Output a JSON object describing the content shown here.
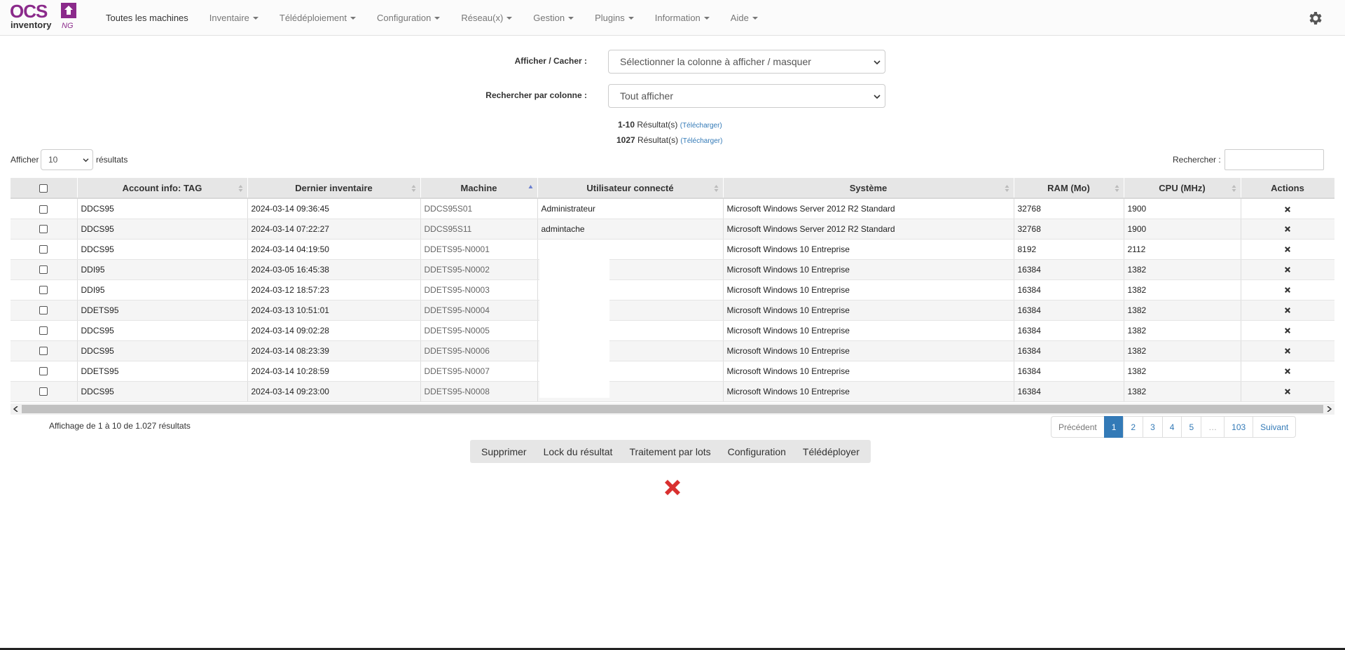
{
  "navbar": {
    "logo_text": "OCS inventory NG",
    "items": [
      {
        "label": "Toutes les machines"
      },
      {
        "label": "Inventaire"
      },
      {
        "label": "Télédéploiement"
      },
      {
        "label": "Configuration"
      },
      {
        "label": "Réseau(x)"
      },
      {
        "label": "Gestion"
      },
      {
        "label": "Plugins"
      },
      {
        "label": "Information"
      },
      {
        "label": "Aide"
      }
    ],
    "settings_icon": "gear-icon"
  },
  "filters": {
    "show_hide_label": "Afficher / Cacher :",
    "show_hide_value": "Sélectionner la colonne à afficher / masquer",
    "search_col_label": "Rechercher par colonne :",
    "search_col_value": "Tout afficher"
  },
  "results": {
    "range": "1-10",
    "range_suffix": "Résultat(s)",
    "range_link": "(Télécharger)",
    "total": "1027",
    "total_suffix": "Résultat(s)",
    "total_link": "(Télécharger)"
  },
  "length": {
    "prefix": "Afficher",
    "value": "10",
    "suffix": "résultats"
  },
  "search": {
    "label": "Rechercher :",
    "value": ""
  },
  "table": {
    "columns": [
      "Account info: TAG",
      "Dernier inventaire",
      "Machine",
      "Utilisateur connecté",
      "Système",
      "RAM (Mo)",
      "CPU (MHz)",
      "Actions"
    ],
    "rows": [
      {
        "tag": "DDCS95",
        "date": "2024-03-14 09:36:45",
        "machine": "DDCS95S01",
        "user": "Administrateur",
        "os": "Microsoft Windows Server 2012 R2 Standard",
        "ram": "32768",
        "cpu": "1900"
      },
      {
        "tag": "DDCS95",
        "date": "2024-03-14 07:22:27",
        "machine": "DDCS95S11",
        "user": "admintache",
        "os": "Microsoft Windows Server 2012 R2 Standard",
        "ram": "32768",
        "cpu": "1900"
      },
      {
        "tag": "DDCS95",
        "date": "2024-03-14 04:19:50",
        "machine": "DDETS95-N0001",
        "user": "",
        "os": "Microsoft Windows 10 Entreprise",
        "ram": "8192",
        "cpu": "2112"
      },
      {
        "tag": "DDI95",
        "date": "2024-03-05 16:45:38",
        "machine": "DDETS95-N0002",
        "user": "",
        "os": "Microsoft Windows 10 Entreprise",
        "ram": "16384",
        "cpu": "1382"
      },
      {
        "tag": "DDI95",
        "date": "2024-03-12 18:57:23",
        "machine": "DDETS95-N0003",
        "user": "",
        "os": "Microsoft Windows 10 Entreprise",
        "ram": "16384",
        "cpu": "1382"
      },
      {
        "tag": "DDETS95",
        "date": "2024-03-13 10:51:01",
        "machine": "DDETS95-N0004",
        "user": "",
        "os": "Microsoft Windows 10 Entreprise",
        "ram": "16384",
        "cpu": "1382"
      },
      {
        "tag": "DDCS95",
        "date": "2024-03-14 09:02:28",
        "machine": "DDETS95-N0005",
        "user": "",
        "os": "Microsoft Windows 10 Entreprise",
        "ram": "16384",
        "cpu": "1382"
      },
      {
        "tag": "DDCS95",
        "date": "2024-03-14 08:23:39",
        "machine": "DDETS95-N0006",
        "user": "",
        "os": "Microsoft Windows 10 Entreprise",
        "ram": "16384",
        "cpu": "1382"
      },
      {
        "tag": "DDETS95",
        "date": "2024-03-14 10:28:59",
        "machine": "DDETS95-N0007",
        "user": "",
        "os": "Microsoft Windows 10 Entreprise",
        "ram": "16384",
        "cpu": "1382"
      },
      {
        "tag": "DDCS95",
        "date": "2024-03-14 09:23:00",
        "machine": "DDETS95-N0008",
        "user": "",
        "os": "Microsoft Windows 10 Entreprise",
        "ram": "16384",
        "cpu": "1382"
      }
    ]
  },
  "footer": {
    "info": "Affichage de 1 à 10 de 1.027 résultats",
    "pagination": [
      "Précédent",
      "1",
      "2",
      "3",
      "4",
      "5",
      "…",
      "103",
      "Suivant"
    ],
    "actions": [
      "Supprimer",
      "Lock du résultat",
      "Traitement par lots",
      "Configuration",
      "Télédéployer"
    ]
  },
  "colors": {
    "brand_purple": "#8b2a8b",
    "accent_blue": "#337ab7",
    "delete_red": "#d9302f"
  }
}
